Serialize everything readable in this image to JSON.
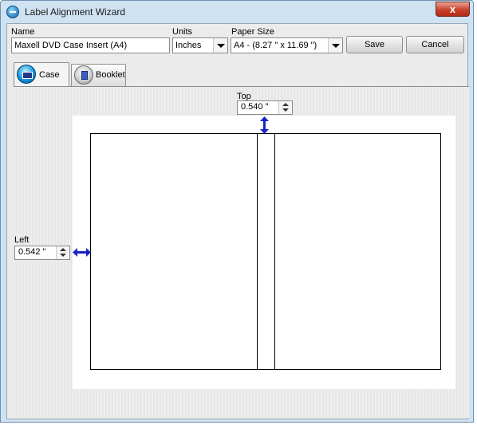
{
  "window": {
    "title": "Label Alignment Wizard",
    "close_glyph": "x"
  },
  "header": {
    "name_label": "Name",
    "name_value": "Maxell DVD Case Insert (A4)",
    "units_label": "Units",
    "units_value": "Inches",
    "paper_size_label": "Paper Size",
    "paper_size_value": "A4 - (8.27 \" x 11.69 \")",
    "save_label": "Save",
    "cancel_label": "Cancel"
  },
  "tabs": [
    {
      "label": "Case",
      "selected": true,
      "icon": "dvd-case-icon"
    },
    {
      "label": "Booklet",
      "selected": false,
      "icon": "booklet-icon"
    }
  ],
  "offsets": {
    "top_label": "Top",
    "top_value": "0.540 \"",
    "left_label": "Left",
    "left_value": "0.542 \""
  },
  "colors": {
    "arrow": "#1a22c8",
    "close": "#c7402b"
  }
}
